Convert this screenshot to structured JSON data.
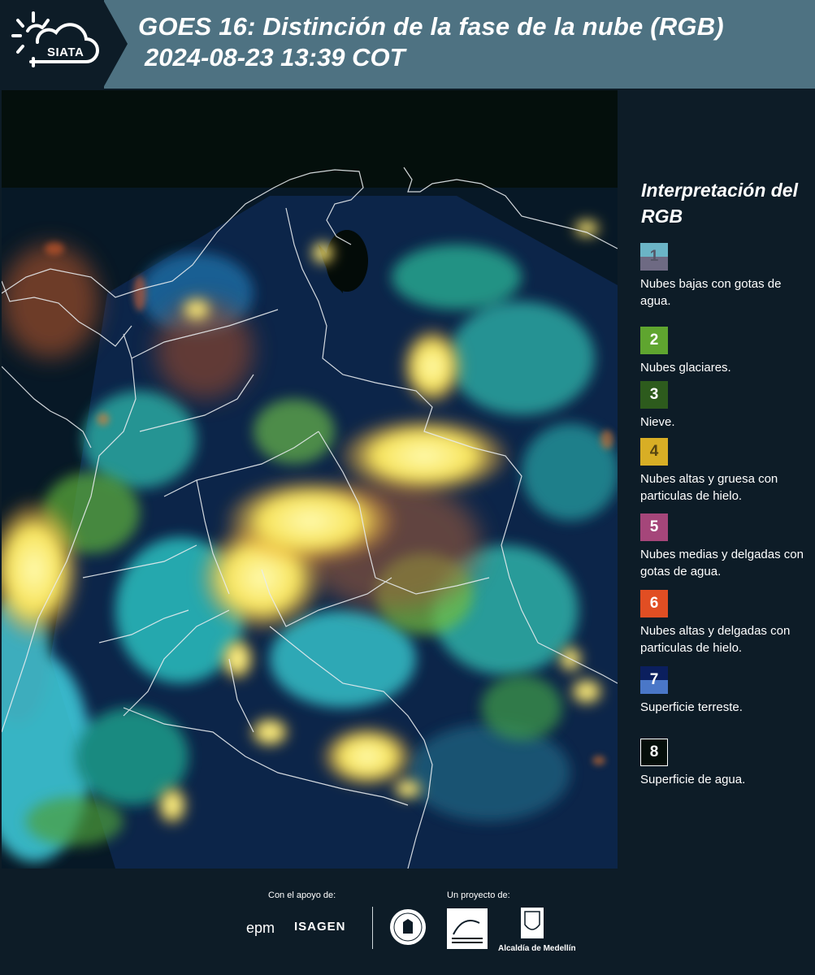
{
  "header": {
    "logo_text": "SIATA",
    "title": "GOES 16: Distinción de la fase de la nube (RGB)",
    "subtitle": "2024-08-23 13:39 COT"
  },
  "legend": {
    "title": "Interpretación del RGB",
    "items": [
      {
        "num": "1",
        "label": "Nubes bajas con gotas de agua.",
        "color_top": "#6bb4c6",
        "color_bottom": "#6e6a83",
        "text_color": "#555566"
      },
      {
        "num": "2",
        "label": "Nubes glaciares.",
        "color_top": "#5fa52f",
        "color_bottom": "#5fa52f",
        "text_color": "#ffffff"
      },
      {
        "num": "3",
        "label": "Nieve.",
        "color_top": "#2d5b1d",
        "color_bottom": "#2d5b1d",
        "text_color": "#ffffff"
      },
      {
        "num": "4",
        "label": "Nubes altas y gruesa con particulas de hielo.",
        "color_top": "#d8ae25",
        "color_bottom": "#d8ae25",
        "text_color": "#554411"
      },
      {
        "num": "5",
        "label": "Nubes medias y delgadas con gotas de agua.",
        "color_top": "#a5467a",
        "color_bottom": "#a5467a",
        "text_color": "#ffffff"
      },
      {
        "num": "6",
        "label": "Nubes altas y delgadas con particulas de hielo.",
        "color_top": "#e14e23",
        "color_bottom": "#e14e23",
        "text_color": "#ffffff"
      },
      {
        "num": "7",
        "label": "Superficie terreste.",
        "color_top": "#0b1f5e",
        "color_bottom": "#4a77c8",
        "text_color": "#ffffff"
      },
      {
        "num": "8",
        "label": "Superficie de agua.",
        "color_top": "#050e0a",
        "color_bottom": "#050e0a",
        "text_color": "#ffffff"
      }
    ]
  },
  "footer": {
    "support_label": "Con el apoyo de:",
    "project_label": "Un proyecto de:",
    "sponsor_1": "epm",
    "sponsor_2": "ISAGEN",
    "partner_3": "Alcaldía de Medellín"
  },
  "map": {
    "background_color": "#071826",
    "border_color": "#e8ecef"
  }
}
